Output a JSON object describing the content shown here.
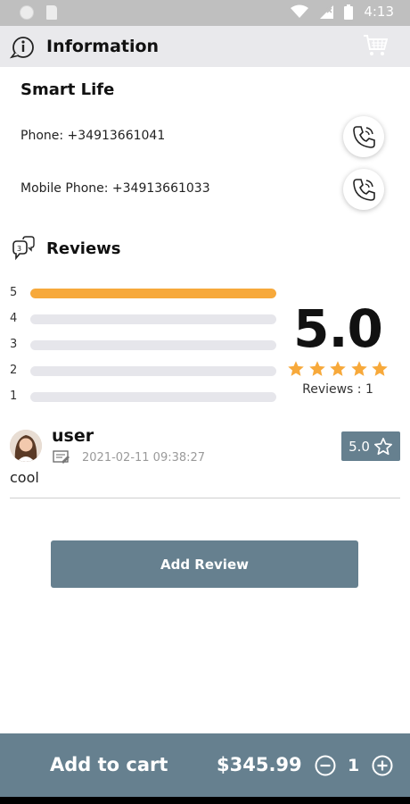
{
  "status_bar": {
    "time": "4:13"
  },
  "header": {
    "title": "Information"
  },
  "company": {
    "name": "Smart Life",
    "phone_label": "Phone: +34913661041",
    "mobile_label": "Mobile Phone: +34913661033"
  },
  "reviews": {
    "title": "Reviews",
    "distribution": [
      {
        "stars": "5",
        "fraction": 1.0
      },
      {
        "stars": "4",
        "fraction": 0
      },
      {
        "stars": "3",
        "fraction": 0
      },
      {
        "stars": "2",
        "fraction": 0
      },
      {
        "stars": "1",
        "fraction": 0
      }
    ],
    "average": "5.0",
    "star_count": 5,
    "count_label": "Reviews : 1",
    "items": [
      {
        "user": "user",
        "date": "2021-02-11 09:38:27",
        "comment": "cool",
        "rating": "5.0"
      }
    ]
  },
  "actions": {
    "add_review": "Add Review"
  },
  "cart": {
    "add_label": "Add to cart",
    "price": "$345.99",
    "quantity": "1"
  },
  "colors": {
    "accent": "#66808f",
    "star": "#f7a93b",
    "bar_track": "#e6e6eb"
  }
}
